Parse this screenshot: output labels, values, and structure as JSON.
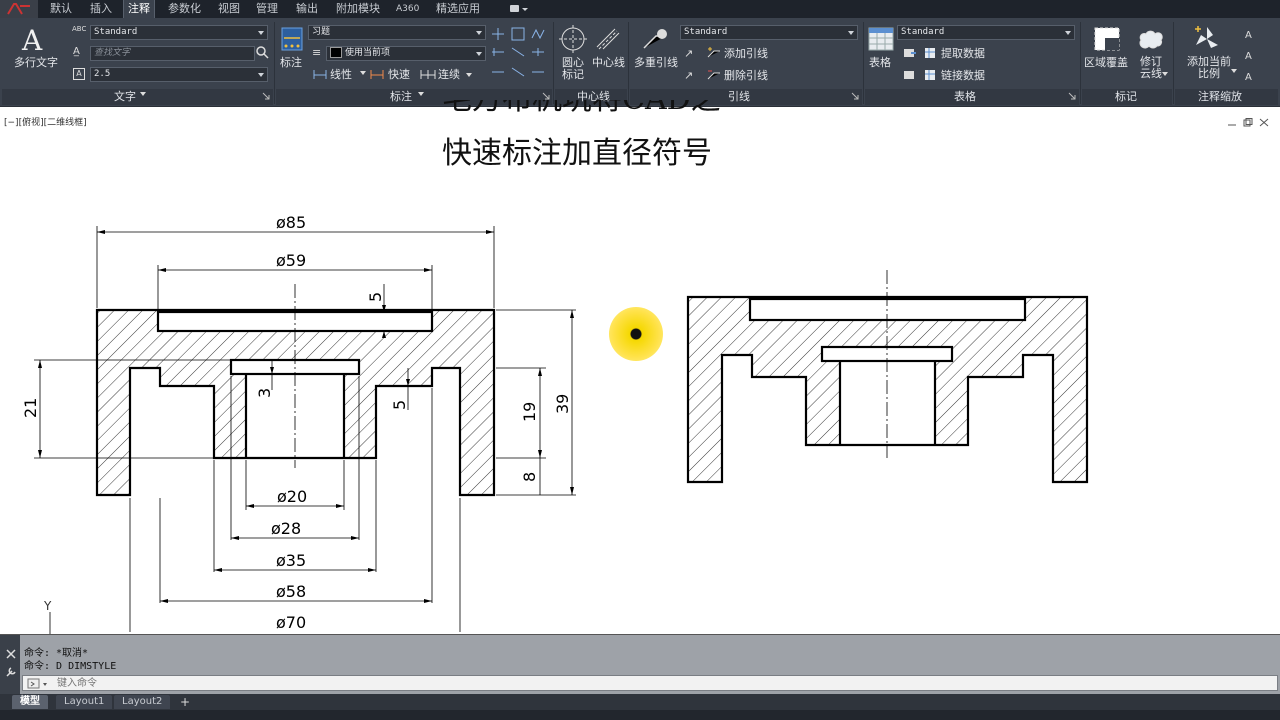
{
  "ribbon_tabs": [
    "默认",
    "插入",
    "注释",
    "参数化",
    "视图",
    "管理",
    "输出",
    "附加模块",
    "A360",
    "精选应用"
  ],
  "active_tab": "注释",
  "text_panel": {
    "big_button": "多行文字",
    "style_combo": "Standard",
    "find_text_placeholder": "查找文字",
    "height_combo": "2.5",
    "title": "文字"
  },
  "dim_panel": {
    "big_button": "标注",
    "style_combo": "习题",
    "layer_combo": "使用当前项",
    "linear_label": "线性",
    "quick_label": "快速",
    "continue_label": "连续",
    "title": "标注"
  },
  "centerline_panel": {
    "center_mark": "圆心标记",
    "center_line": "中心线",
    "title": "中心线"
  },
  "leader_panel": {
    "big_button": "多重引线",
    "style_combo": "Standard",
    "add_leader": "添加引线",
    "remove_leader": "删除引线",
    "title": "引线"
  },
  "table_panel": {
    "big_button": "表格",
    "style_combo": "Standard",
    "extract_data": "提取数据",
    "link_data": "链接数据",
    "title": "表格"
  },
  "markup_panel": {
    "wipeout": "区域覆盖",
    "revcloud": "修订云线",
    "title": "标记"
  },
  "annoscale_panel": {
    "add_current_scale": "添加当前比例",
    "title": "注释缩放"
  },
  "viewport": {
    "label": "[−][俯视][二维线框]",
    "title_line1": "毛万布机坑将CAD之",
    "title_line2": "快速标注加直径符号"
  },
  "drawing": {
    "diameter_dims": [
      "ø85",
      "ø59",
      "ø20",
      "ø28",
      "ø35",
      "ø58",
      "ø70"
    ],
    "linear_dims": [
      "5",
      "3",
      "5",
      "21",
      "19",
      "39",
      "8"
    ],
    "ucs_y": "Y"
  },
  "command": {
    "history": [
      "命令: *取消*",
      "命令: D DIMSTYLE"
    ],
    "placeholder": "键入命令"
  },
  "layout_tabs": [
    "模型",
    "Layout1",
    "Layout2"
  ],
  "add_layout": "+",
  "colors": {
    "ribbon_bg": "#3b424d",
    "tabbar_bg": "#1e232b",
    "cursor_highlight": "#ffe24a"
  }
}
